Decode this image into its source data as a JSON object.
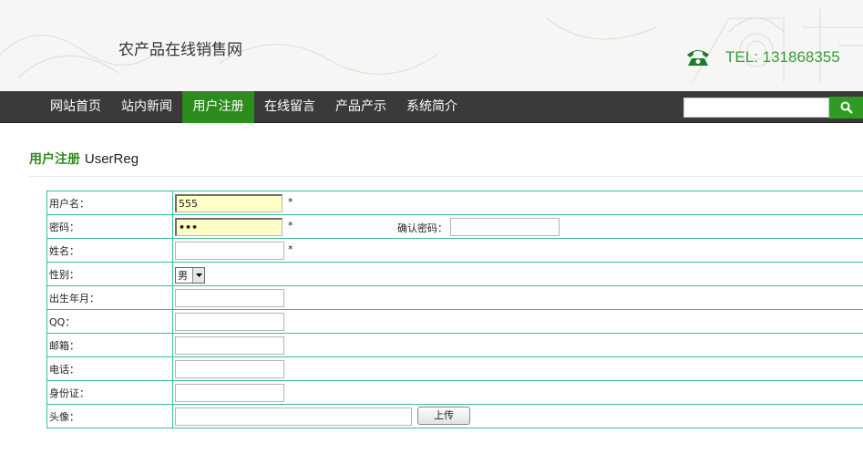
{
  "header": {
    "site_title": "农产品在线销售网",
    "tel_text": "TEL: 131868355",
    "tel_icon": "phone-icon"
  },
  "nav": {
    "items": [
      "网站首页",
      "站内新闻",
      "用户注册",
      "在线留言",
      "产品产示",
      "系统简介"
    ],
    "active_index": 2,
    "search_placeholder": "",
    "search_icon": "search-icon"
  },
  "page": {
    "heading_cn": "用户注册",
    "heading_en": "UserReg"
  },
  "form": {
    "username_label": "用户名：",
    "username_value": "555",
    "password_label": "密码：",
    "password_value": "•••",
    "confirm_label": "确认密码：",
    "confirm_value": "",
    "name_label": "姓名：",
    "name_value": "",
    "gender_label": "性别：",
    "gender_value": "男",
    "birth_label": "出生年月：",
    "birth_value": "",
    "qq_label": "QQ：",
    "qq_value": "",
    "email_label": "邮箱：",
    "email_value": "",
    "phone_label": "电话：",
    "phone_value": "",
    "id_label": "身份证：",
    "id_value": "",
    "avatar_label": "头像：",
    "upload_label": "上传",
    "required_mark": "*"
  },
  "colors": {
    "accent": "#2e8b1e",
    "nav_bg": "#3a3a3a",
    "table_border": "#3bbf8e",
    "tel": "#3a9a3a"
  }
}
